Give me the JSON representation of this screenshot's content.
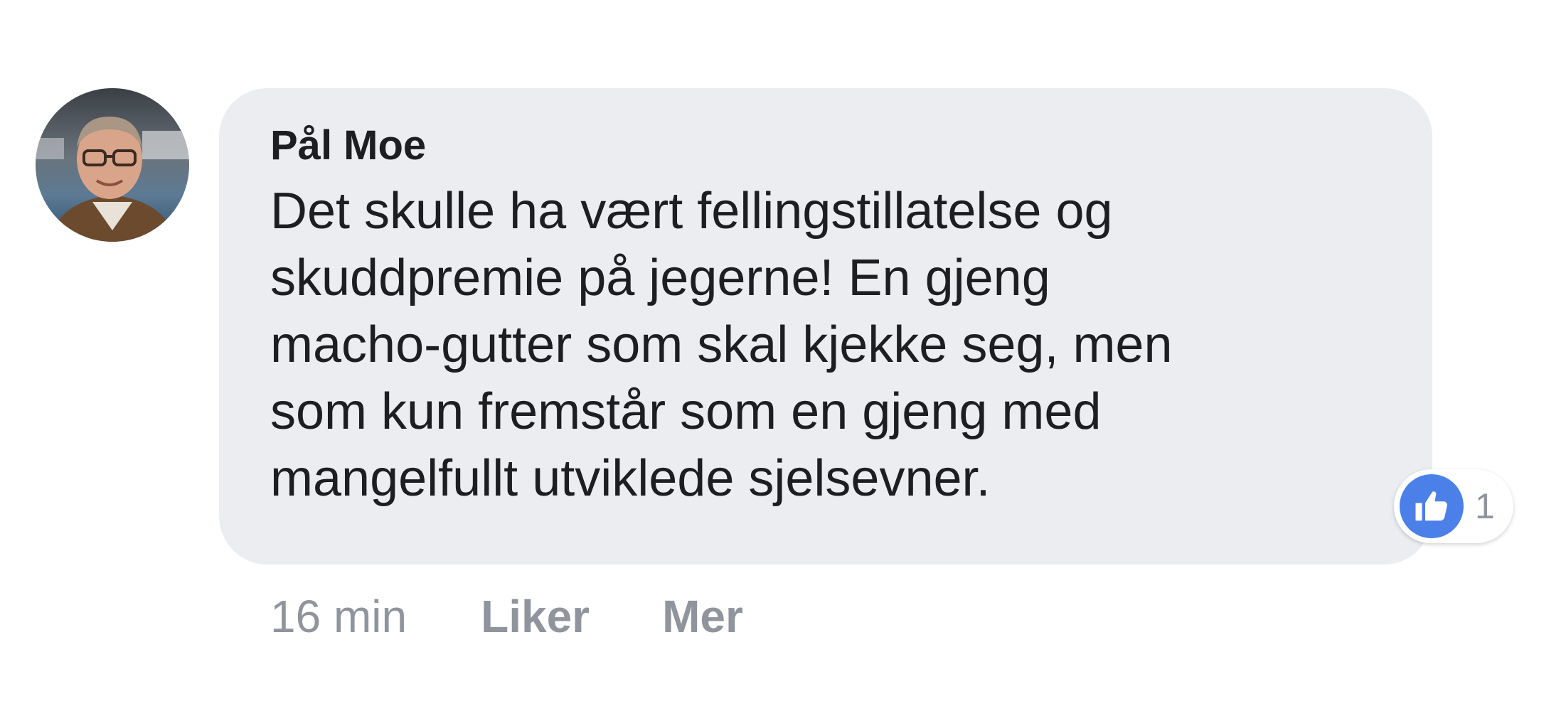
{
  "comment": {
    "author": "Pål Moe",
    "lines": [
      "Det skulle ha vært fellingstillatelse og",
      "skuddpremie på jegerne! En gjeng",
      "macho-gutter som skal kjekke seg, men",
      "som kun fremstår som en gjeng med",
      "mangelfullt utviklede sjelsevner."
    ],
    "avatar_icon": "profile-photo",
    "reactions": {
      "icon": "thumbs-up-icon",
      "count": "1",
      "color": "#4a80e8"
    }
  },
  "actions": {
    "time": "16 min",
    "like_label": "Liker",
    "more_label": "Mer"
  }
}
